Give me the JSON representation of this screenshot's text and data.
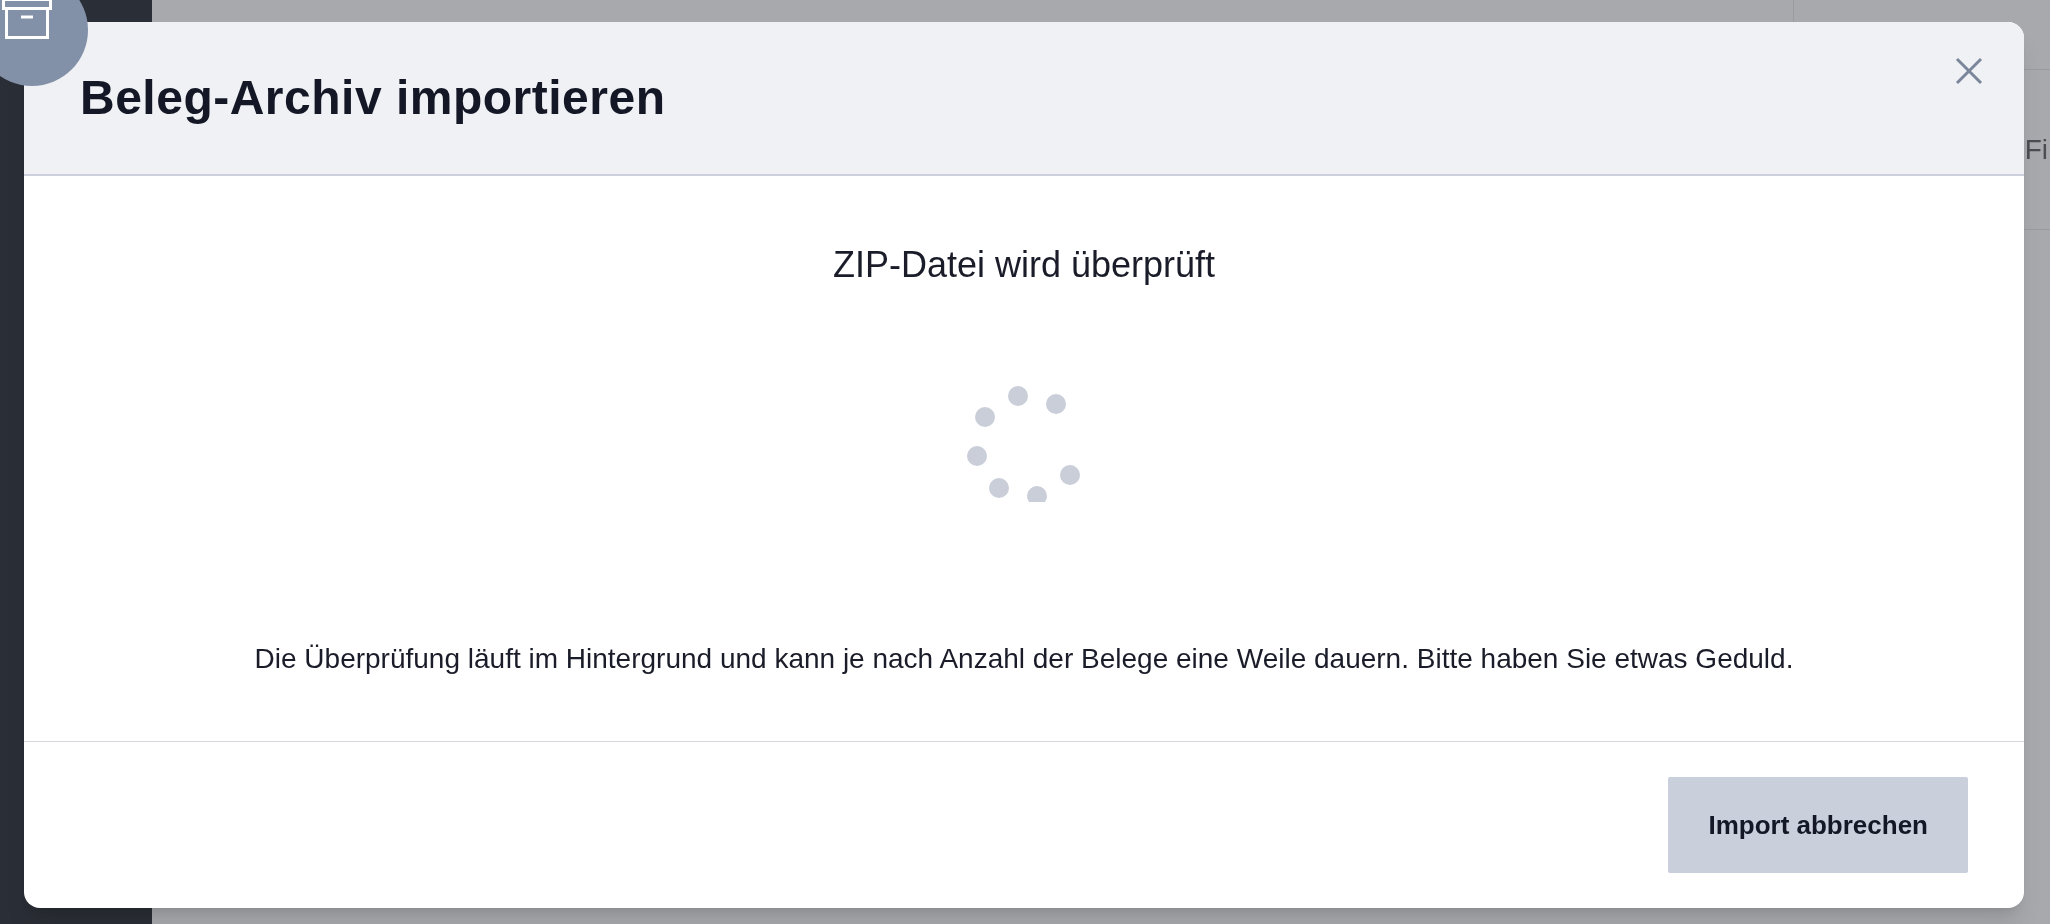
{
  "background": {
    "column_label": "Fi"
  },
  "dialog": {
    "title": "Beleg-Archiv importieren",
    "status": "ZIP-Datei wird überprüft",
    "message": "Die Überprüfung läuft im Hintergrund und kann je nach Anzahl der Belege eine Weile dauern. Bitte haben Sie etwas Geduld.",
    "buttons": [
      "Import abbrechen"
    ]
  }
}
